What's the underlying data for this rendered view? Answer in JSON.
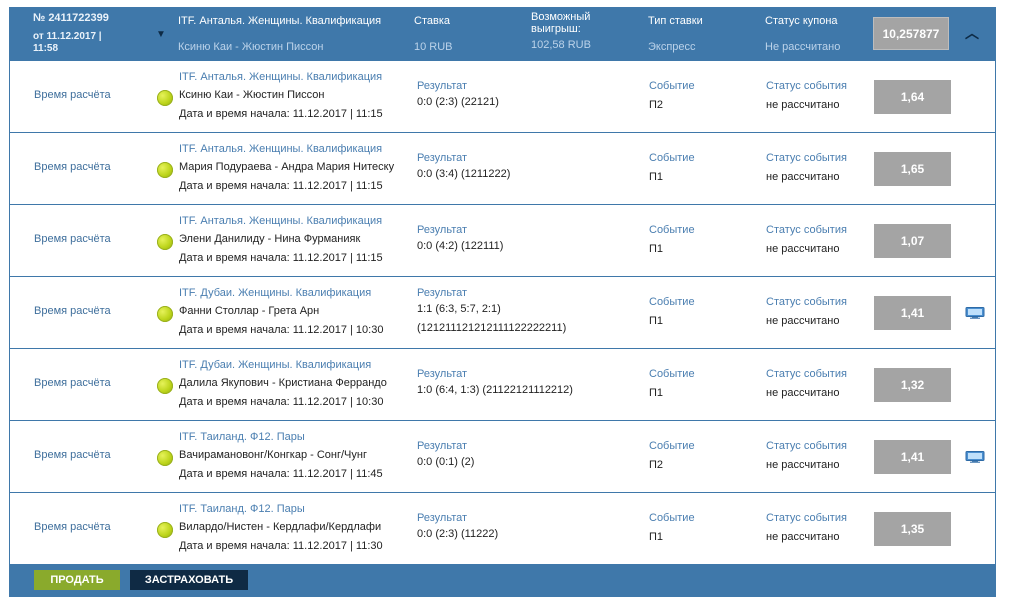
{
  "coupon": {
    "number": "№ 2411722399",
    "date": "от 11.12.2017 | 11:58",
    "event_label": "ITF. Анталья. Женщины. Квалификация",
    "event_players": "Ксиню Каи - Жюстин Писсон",
    "stake_label": "Ставка",
    "stake_value": "10 RUB",
    "win_label": "Возможный выигрыш:",
    "win_value": "102,58 RUB",
    "bet_type_label": "Тип ставки",
    "bet_type_value": "Экспресс",
    "status_label": "Статус купона",
    "status_value": "Не рассчитано",
    "total_odds": "10,257877"
  },
  "labels": {
    "calc_time": "Время расчёта",
    "start_prefix": "Дата и время начала:",
    "result": "Результат",
    "event": "Событие",
    "event_status": "Статус события"
  },
  "rows": [
    {
      "tournament": "ITF. Анталья. Женщины. Квалификация",
      "match": "Ксиню Каи - Жюстин Писсон",
      "start": "Дата и время начала: 11.12.2017 | 11:15",
      "result_lines": [
        "0:0 (2:3) (22121)"
      ],
      "event": "П2",
      "status": "не рассчитано",
      "odds": "1,64",
      "tv": false
    },
    {
      "tournament": "ITF. Анталья. Женщины. Квалификация",
      "match": "Мария Подураева - Андра Мария Нитеску",
      "start": "Дата и время начала: 11.12.2017 | 11:15",
      "result_lines": [
        "0:0 (3:4) (1211222)"
      ],
      "event": "П1",
      "status": "не рассчитано",
      "odds": "1,65",
      "tv": false
    },
    {
      "tournament": "ITF. Анталья. Женщины. Квалификация",
      "match": "Элени Данилиду - Нина Фурманияк",
      "start": "Дата и время начала: 11.12.2017 | 11:15",
      "result_lines": [
        "0:0 (4:2) (122111)"
      ],
      "event": "П1",
      "status": "не рассчитано",
      "odds": "1,07",
      "tv": false
    },
    {
      "tournament": "ITF. Дубаи. Женщины. Квалификация",
      "match": "Фанни Столлар - Грета Арн",
      "start": "Дата и время начала: 11.12.2017 | 10:30",
      "result_lines": [
        "1:1 (6:3, 5:7, 2:1)",
        "(121211121212111122222211)"
      ],
      "event": "П1",
      "status": "не рассчитано",
      "odds": "1,41",
      "tv": true
    },
    {
      "tournament": "ITF. Дубаи. Женщины. Квалификация",
      "match": "Далила Якупович - Кристиана Феррандо",
      "start": "Дата и время начала: 11.12.2017 | 10:30",
      "result_lines": [
        "1:0 (6:4, 1:3) (21122121112212)"
      ],
      "event": "П1",
      "status": "не рассчитано",
      "odds": "1,32",
      "tv": false
    },
    {
      "tournament": "ITF. Таиланд. Ф12. Пары",
      "match": "Вачирамановонг/Конгкар - Сонг/Чунг",
      "start": "Дата и время начала: 11.12.2017 | 11:45",
      "result_lines": [
        "0:0 (0:1) (2)"
      ],
      "event": "П2",
      "status": "не рассчитано",
      "odds": "1,41",
      "tv": true
    },
    {
      "tournament": "ITF. Таиланд. Ф12. Пары",
      "match": "Вилардо/Нистен - Кердлафи/Кердлафи",
      "start": "Дата и время начала: 11.12.2017 | 11:30",
      "result_lines": [
        "0:0 (2:3) (11222)"
      ],
      "event": "П1",
      "status": "не рассчитано",
      "odds": "1,35",
      "tv": false
    }
  ],
  "footer": {
    "sell_label": "ПРОДАТЬ",
    "insure_label": "ЗАСТРАХОВАТЬ"
  },
  "icons": {
    "expand_arrow": "caret-down-icon",
    "collapse": "chevron-up-icon",
    "sport": "tennis-ball-icon",
    "broadcast": "tv-icon"
  },
  "colors": {
    "header_bg": "#3f78aa",
    "odds_bg": "#a4a4a4",
    "sell_btn": "#8aaa2c",
    "insure_btn": "#0f2a44",
    "link_text": "#4a7eb0"
  }
}
